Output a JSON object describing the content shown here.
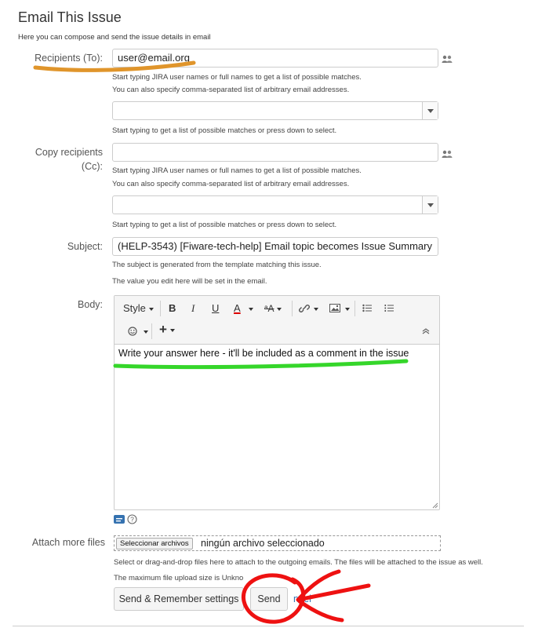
{
  "header": {
    "title": "Email This Issue",
    "description": "Here you can compose and send the issue details in email"
  },
  "recipients_to": {
    "label": "Recipients (To):",
    "value": "user@email.org",
    "help1": "Start typing JIRA user names or full names to get a list of possible matches.",
    "help2": "You can also specify comma-separated list of arbitrary email addresses.",
    "select_help": "Start typing to get a list of possible matches or press down to select."
  },
  "recipients_cc": {
    "label": "Copy recipients (Cc):",
    "value": "",
    "help1": "Start typing JIRA user names or full names to get a list of possible matches.",
    "help2": "You can also specify comma-separated list of arbitrary email addresses.",
    "select_help": "Start typing to get a list of possible matches or press down to select."
  },
  "subject": {
    "label": "Subject:",
    "value": "(HELP-3543) [Fiware-tech-help] Email topic becomes Issue Summary",
    "help1": "The subject is generated from the template matching this issue.",
    "help2": "The value you edit here will be set in the email."
  },
  "body": {
    "label": "Body:",
    "toolbar": {
      "style": "Style",
      "bold": "B",
      "italic": "I",
      "underline": "U",
      "text_color": "A",
      "clear_format": "ᵃA",
      "add": "+"
    },
    "content": "Write your answer here - it'll be included as a comment in the issue"
  },
  "attach": {
    "label": "Attach more files",
    "button": "Seleccionar archivos",
    "status": "ningún archivo seleccionado",
    "help1": "Select or drag-and-drop files here to attach to the outgoing emails. The files will be attached to the issue as well.",
    "help2": "The maximum file upload size is Unkno"
  },
  "actions": {
    "send_remember": "Send & Remember settings",
    "send": "Send",
    "cancel_partial": "ncel"
  },
  "annotation_colors": {
    "orange": "#e0952b",
    "green": "#35d62a",
    "red": "#ee1111"
  }
}
